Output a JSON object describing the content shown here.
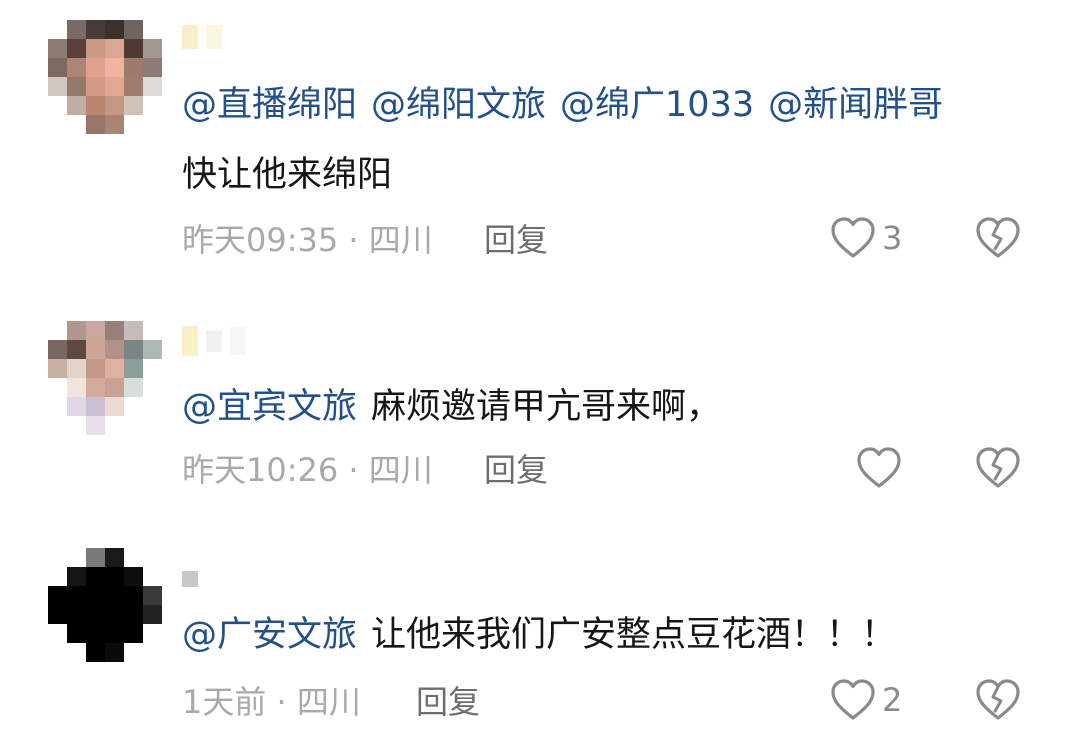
{
  "comments": [
    {
      "mentions": [
        "@直播绵阳",
        "@绵阳文旅",
        "@绵广1033",
        "@新闻胖哥"
      ],
      "text": "快让他来绵阳",
      "time": "昨天09:35",
      "location": "四川",
      "reply_label": "回复",
      "likes": "3"
    },
    {
      "mentions": [
        "@宜宾文旅"
      ],
      "text": "麻烦邀请甲亢哥来啊，",
      "time": "昨天10:26",
      "location": "四川",
      "reply_label": "回复",
      "likes": ""
    },
    {
      "mentions": [
        "@广安文旅"
      ],
      "text": "让他来我们广安整点豆花酒！！！",
      "time": "1天前",
      "location": "四川",
      "reply_label": "回复",
      "likes": "2"
    }
  ],
  "colors": {
    "mention": "#24508a",
    "text": "#161616",
    "meta": "#a9a9a9",
    "icon": "#8a8a8a"
  },
  "icons": {
    "like": "heart-outline-icon",
    "dislike": "broken-heart-icon"
  }
}
